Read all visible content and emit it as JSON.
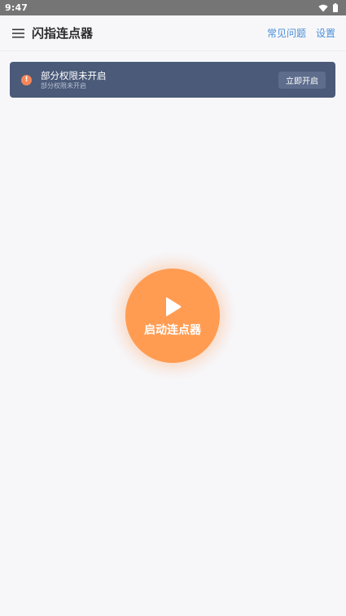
{
  "status_bar": {
    "time": "9:47",
    "icons": [
      "wifi-icon",
      "battery-icon"
    ]
  },
  "app_bar": {
    "title": "闪指连点器",
    "menu_icon": "hamburger-menu-icon",
    "faq_label": "常见问题",
    "settings_label": "设置"
  },
  "banner": {
    "icon": "warning-icon",
    "title": "部分权限未开启",
    "subtitle": "部分权限未开启",
    "button_label": "立即开启"
  },
  "start_button": {
    "icon": "play-icon",
    "label": "启动连点器"
  },
  "colors": {
    "accent_orange": "#ff9c52",
    "banner_bg": "#4a5a78",
    "link_blue": "#4a8fd6",
    "warning": "#f4865a"
  }
}
